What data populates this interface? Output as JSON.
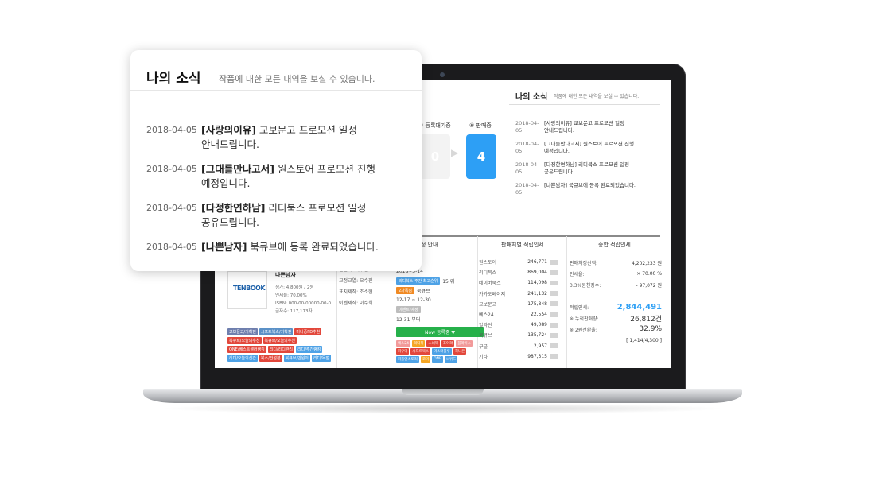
{
  "popup": {
    "title": "나의 소식",
    "subtitle": "작품에 대한 모든 내역을 보실 수 있습니다.",
    "items": [
      {
        "date": "2018-04-05",
        "tag": "[사랑의이유]",
        "text": "교보문고 프로모션 일정",
        "text2": "안내드립니다."
      },
      {
        "date": "2018-04-05",
        "tag": "[그대를만나고서]",
        "text": "원스토어 프로모션 진행",
        "text2": "예정입니다."
      },
      {
        "date": "2018-04-05",
        "tag": "[다정한연하남]",
        "text": "리디북스 프로모션 일정",
        "text2": "공유드립니다."
      },
      {
        "date": "2018-04-05",
        "tag": "[나쁜남자]",
        "text": "북큐브에 등록 완료되었습니다.",
        "text2": ""
      }
    ]
  },
  "screen": {
    "news_title": "나의 소식",
    "news_subtitle": "작품에 대한 모든 내역을 보실 수 있습니다.",
    "news_items": [
      {
        "date": "2018-04-05",
        "line1": "[사랑의이유] 교보문고 프로모션 일정",
        "line2": "안내드립니다."
      },
      {
        "date": "2018-04-05",
        "line1": "[그대를만나고서] 원스토어 프로모션 진행",
        "line2": "예정입니다."
      },
      {
        "date": "2018-04-05",
        "line1": "[다정한연하남] 리디북스 프로모션 일정",
        "line2": "공유드립니다."
      },
      {
        "date": "2018-04-05",
        "line1": "[나쁜남자] 북큐브에 등록 완료되었습니다.",
        "line2": ""
      }
    ],
    "steps": [
      {
        "label": "⑤ 등록대기중",
        "value": "0"
      },
      {
        "label": "⑥ 판매중",
        "value": "4"
      }
    ],
    "columns": [
      "간일정 안내",
      "판매처별 적립인세",
      "종합 적립인세"
    ],
    "book": {
      "logo": "TENBOOK",
      "title": "나쁜남자",
      "meta": [
        "정가: 4,800원 / 2원",
        "인세율: 70.00%",
        "ISBN: 000-00-00000-00-0",
        "글자수: 117,173자"
      ],
      "info": [
        "편집자: 이우철",
        "교정교열: 오수진",
        "표지제작: 조소현",
        "이벤제작: 이수희"
      ]
    },
    "tags": [
      {
        "text": "교보문고/기획전",
        "color": "#6f7fae"
      },
      {
        "text": "시프트북스/기획전",
        "color": "#5b91c7"
      },
      {
        "text": "미니중PD추천",
        "color": "#e2473b"
      },
      {
        "text": "북큐브/오늘의추천",
        "color": "#e2473b"
      },
      {
        "text": "북큐브/오늘의추천",
        "color": "#e2473b"
      },
      {
        "text": "ONE/베스트셀러랭킹",
        "color": "#e2473b"
      },
      {
        "text": "리디/리디관리",
        "color": "#e2473b"
      },
      {
        "text": "리디/주간랭킹",
        "color": "#4ea2e6"
      },
      {
        "text": "리디/오늘의신간",
        "color": "#4ea2e6"
      },
      {
        "text": "북스/건설본",
        "color": "#e2473b"
      },
      {
        "text": "북큐브/만원의",
        "color": "#4ea2e6"
      },
      {
        "text": "리디/독점",
        "color": "#4ea2e6"
      }
    ],
    "schedule": [
      {
        "text": "리디북스",
        "pill": "",
        "pill_color": ""
      },
      {
        "text": "2018~3-14",
        "pill": "",
        "pill_color": ""
      },
      {
        "text": "15 위",
        "pill": "리디북스 주간 최고순위",
        "pill_color": "#4ea2e6"
      },
      {
        "text": "북큐브",
        "pill": "2차독점",
        "pill_color": "#f08a24"
      },
      {
        "text": "12-17 ~ 12-30",
        "pill": "",
        "pill_color": ""
      },
      {
        "text": "",
        "pill": "이벤트 예정",
        "pill_color": "#bdbdbd"
      },
      {
        "text": "12-31 부터",
        "pill": "",
        "pill_color": ""
      }
    ],
    "now_label": "Now 등록중 ▼",
    "mini_tags": [
      {
        "text": "예스24",
        "color": "#f29a9a"
      },
      {
        "text": "리디북",
        "color": "#f5a623"
      },
      {
        "text": "스네북",
        "color": "#e2473b"
      },
      {
        "text": "조아라",
        "color": "#e2473b"
      },
      {
        "text": "블라이스",
        "color": "#f29a9a"
      },
      {
        "text": "피우미",
        "color": "#e2473b"
      },
      {
        "text": "시프트북스",
        "color": "#e2473b"
      },
      {
        "text": "미스터블루",
        "color": "#4ea2e6"
      },
      {
        "text": "하나은",
        "color": "#e2473b"
      },
      {
        "text": "피플앤스토리",
        "color": "#4ea2e6"
      },
      {
        "text": "코미",
        "color": "#f5a623"
      },
      {
        "text": "ONE",
        "color": "#4ea2e6"
      },
      {
        "text": "씨위드",
        "color": "#4ea2e6"
      }
    ],
    "sales": [
      {
        "name": "원스토어",
        "value": "246,771"
      },
      {
        "name": "리디북스",
        "value": "869,004"
      },
      {
        "name": "네이버북스",
        "value": "114,098"
      },
      {
        "name": "카카오페이지",
        "value": "241,132"
      },
      {
        "name": "교보문고",
        "value": "175,848"
      },
      {
        "name": "예스24",
        "value": "22,554"
      },
      {
        "name": "알라딘",
        "value": "49,089"
      },
      {
        "name": "북큐브",
        "value": "135,724"
      },
      {
        "name": "구글",
        "value": "2,957"
      },
      {
        "name": "기타",
        "value": "987,315"
      }
    ],
    "totals": [
      {
        "name": "판매처정산액:",
        "value": "4,202,233 원",
        "style": "normal"
      },
      {
        "name": "인세율:",
        "value": "× 70.00 %",
        "style": "normal"
      },
      {
        "name": "3.3%원천징수:",
        "value": "- 97,072 원",
        "style": "normal"
      },
      {
        "name": "",
        "value": "",
        "style": "normal"
      },
      {
        "name": "적립인세:",
        "value": "2,844,491",
        "style": "big"
      },
      {
        "name": "※ 누적판매량:",
        "value": "26,812건",
        "style": "mid"
      },
      {
        "name": "※ 2원전환율:",
        "value": "32.9%",
        "style": "mid"
      },
      {
        "name": "",
        "value": "[ 1,414/4,300 ]",
        "style": "normal"
      }
    ]
  }
}
